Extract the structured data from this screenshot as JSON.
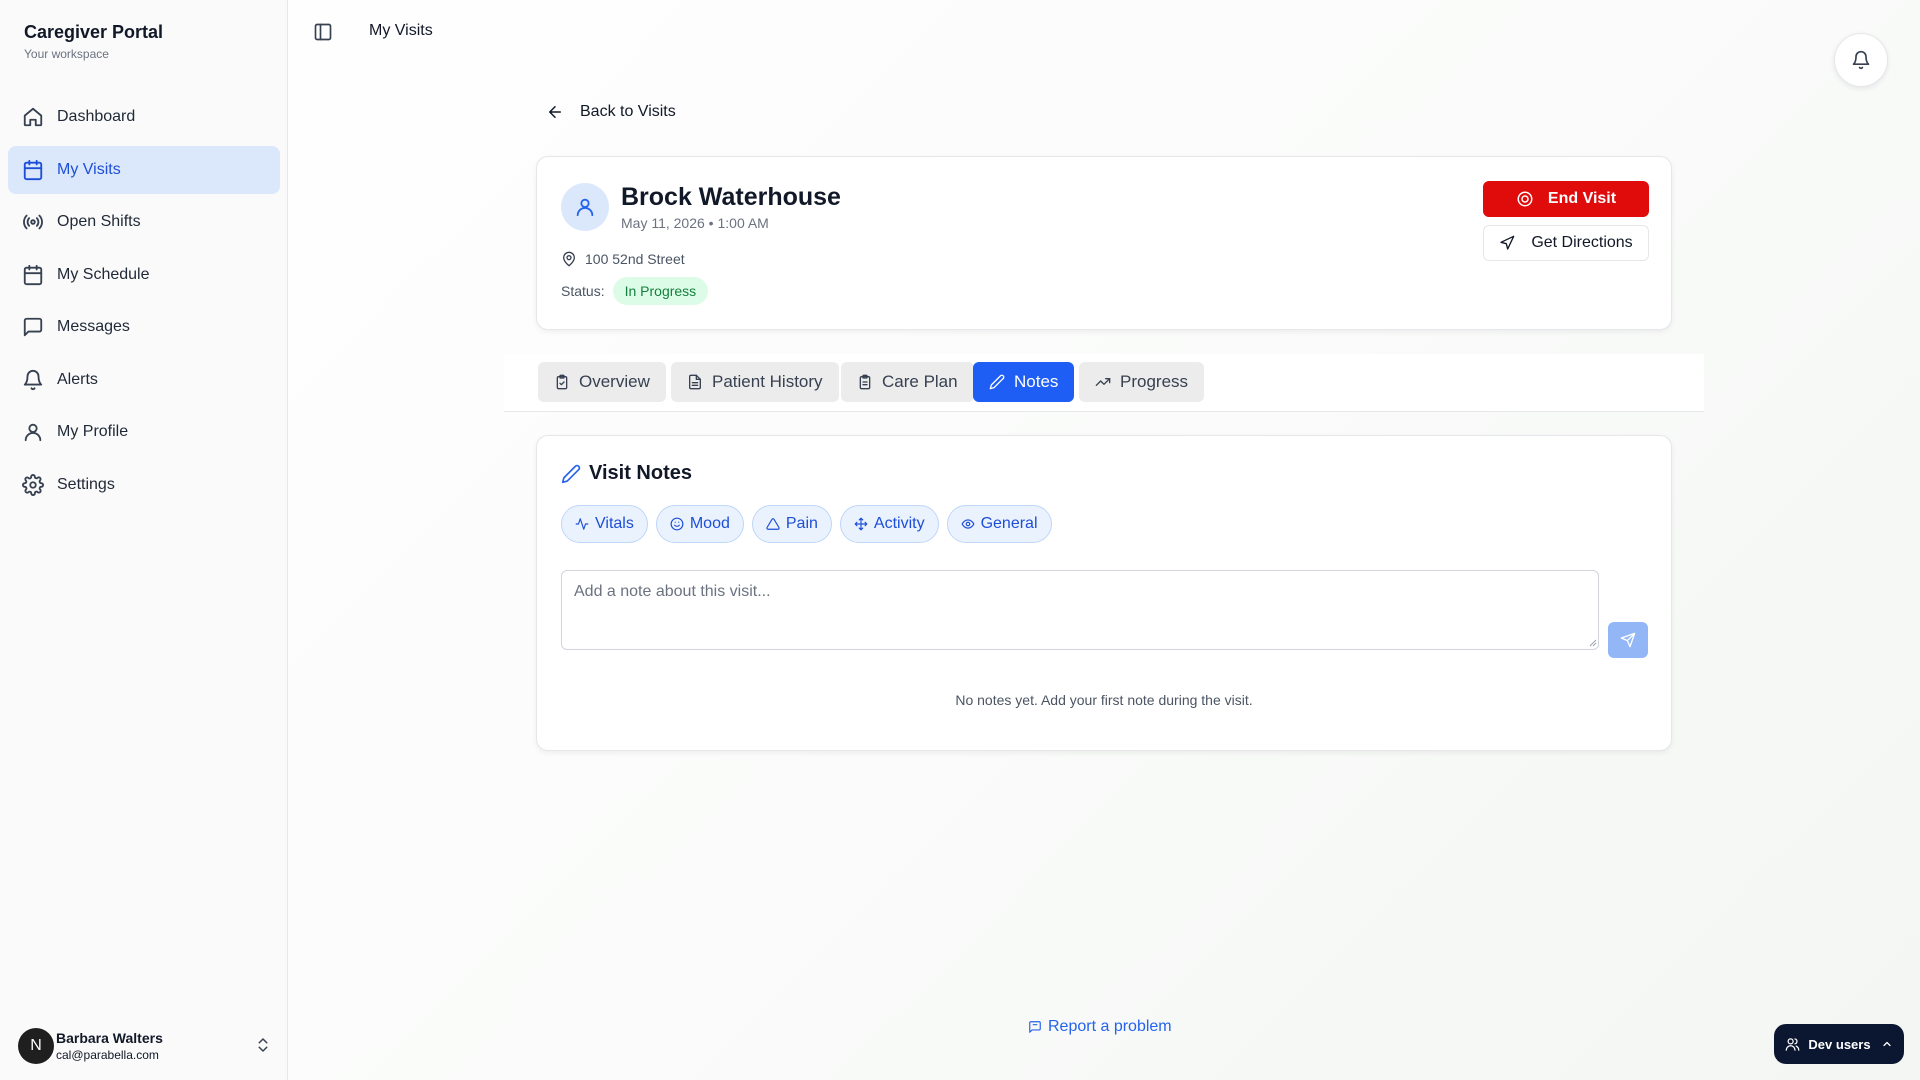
{
  "brand": {
    "title": "Caregiver Portal",
    "subtitle": "Your workspace"
  },
  "sidebar": {
    "items": [
      {
        "label": "Dashboard",
        "icon": "home-icon",
        "active": false
      },
      {
        "label": "My Visits",
        "icon": "calendar-icon",
        "active": true
      },
      {
        "label": "Open Shifts",
        "icon": "radio-icon",
        "active": false
      },
      {
        "label": "My Schedule",
        "icon": "calendar-icon",
        "active": false
      },
      {
        "label": "Messages",
        "icon": "message-icon",
        "active": false
      },
      {
        "label": "Alerts",
        "icon": "bell-icon",
        "active": false
      },
      {
        "label": "My Profile",
        "icon": "user-icon",
        "active": false
      },
      {
        "label": "Settings",
        "icon": "gear-icon",
        "active": false
      }
    ],
    "user": {
      "initial": "N",
      "name": "Barbara Walters",
      "email": "cal@parabella.com"
    }
  },
  "topbar": {
    "title": "My Visits"
  },
  "back": {
    "label": "Back to Visits"
  },
  "patient": {
    "name": "Brock Waterhouse",
    "datetime": "May 11, 2026 • 1:00 AM",
    "address": "100 52nd Street",
    "status_label": "Status:",
    "status": "In Progress",
    "end_visit": "End Visit",
    "directions": "Get Directions"
  },
  "tabs": [
    {
      "label": "Overview",
      "icon": "clipboard-icon",
      "active": false
    },
    {
      "label": "Patient History",
      "icon": "file-icon",
      "active": false
    },
    {
      "label": "Care Plan",
      "icon": "clipboard-list-icon",
      "active": false
    },
    {
      "label": "Notes",
      "icon": "pencil-icon",
      "active": true
    },
    {
      "label": "Progress",
      "icon": "trending-up-icon",
      "active": false
    }
  ],
  "notes": {
    "title": "Visit Notes",
    "chips": [
      {
        "label": "Vitals",
        "icon": "activity-icon"
      },
      {
        "label": "Mood",
        "icon": "smile-icon"
      },
      {
        "label": "Pain",
        "icon": "alert-triangle-icon"
      },
      {
        "label": "Activity",
        "icon": "move-icon"
      },
      {
        "label": "General",
        "icon": "eye-icon"
      }
    ],
    "input_placeholder": "Add a note about this visit...",
    "input_value": "",
    "empty": "No notes yet. Add your first note during the visit."
  },
  "footer": {
    "report": "Report a problem",
    "dev_users": "Dev users"
  },
  "colors": {
    "accent": "#1e5ef5",
    "danger": "#e00b0b",
    "success_bg": "#dcfce7",
    "success_text": "#15803d",
    "active_nav_bg": "#dbe8fb"
  }
}
